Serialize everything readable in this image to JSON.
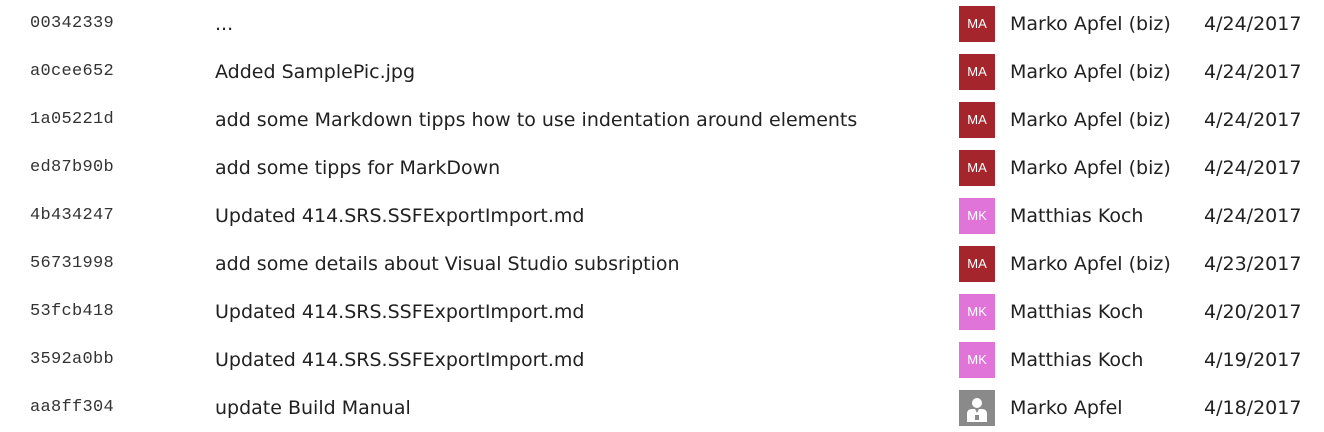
{
  "commits": [
    {
      "hash": "00342339",
      "message": "...",
      "avatar_initials": "MA",
      "avatar_color": "#a4262c",
      "author": "Marko Apfel (biz)",
      "date": "4/24/2017"
    },
    {
      "hash": "a0cee652",
      "message": "Added SamplePic.jpg",
      "avatar_initials": "MA",
      "avatar_color": "#a4262c",
      "author": "Marko Apfel (biz)",
      "date": "4/24/2017"
    },
    {
      "hash": "1a05221d",
      "message": "add some Markdown tipps how to use indentation around elements",
      "avatar_initials": "MA",
      "avatar_color": "#a4262c",
      "author": "Marko Apfel (biz)",
      "date": "4/24/2017"
    },
    {
      "hash": "ed87b90b",
      "message": "add some tipps for MarkDown",
      "avatar_initials": "MA",
      "avatar_color": "#a4262c",
      "author": "Marko Apfel (biz)",
      "date": "4/24/2017"
    },
    {
      "hash": "4b434247",
      "message": "Updated 414.SRS.SSFExportImport.md",
      "avatar_initials": "MK",
      "avatar_color": "#e174d8",
      "author": "Matthias Koch",
      "date": "4/24/2017"
    },
    {
      "hash": "56731998",
      "message": "add some details about Visual Studio subsription",
      "avatar_initials": "MA",
      "avatar_color": "#a4262c",
      "author": "Marko Apfel (biz)",
      "date": "4/23/2017"
    },
    {
      "hash": "53fcb418",
      "message": "Updated 414.SRS.SSFExportImport.md",
      "avatar_initials": "MK",
      "avatar_color": "#e174d8",
      "author": "Matthias Koch",
      "date": "4/20/2017"
    },
    {
      "hash": "3592a0bb",
      "message": "Updated 414.SRS.SSFExportImport.md",
      "avatar_initials": "MK",
      "avatar_color": "#e174d8",
      "author": "Matthias Koch",
      "date": "4/19/2017"
    },
    {
      "hash": "aa8ff304",
      "message": "update Build Manual",
      "avatar_icon": "person-placeholder-icon",
      "avatar_color": "#8a8a8a",
      "author": "Marko Apfel",
      "date": "4/18/2017"
    }
  ]
}
